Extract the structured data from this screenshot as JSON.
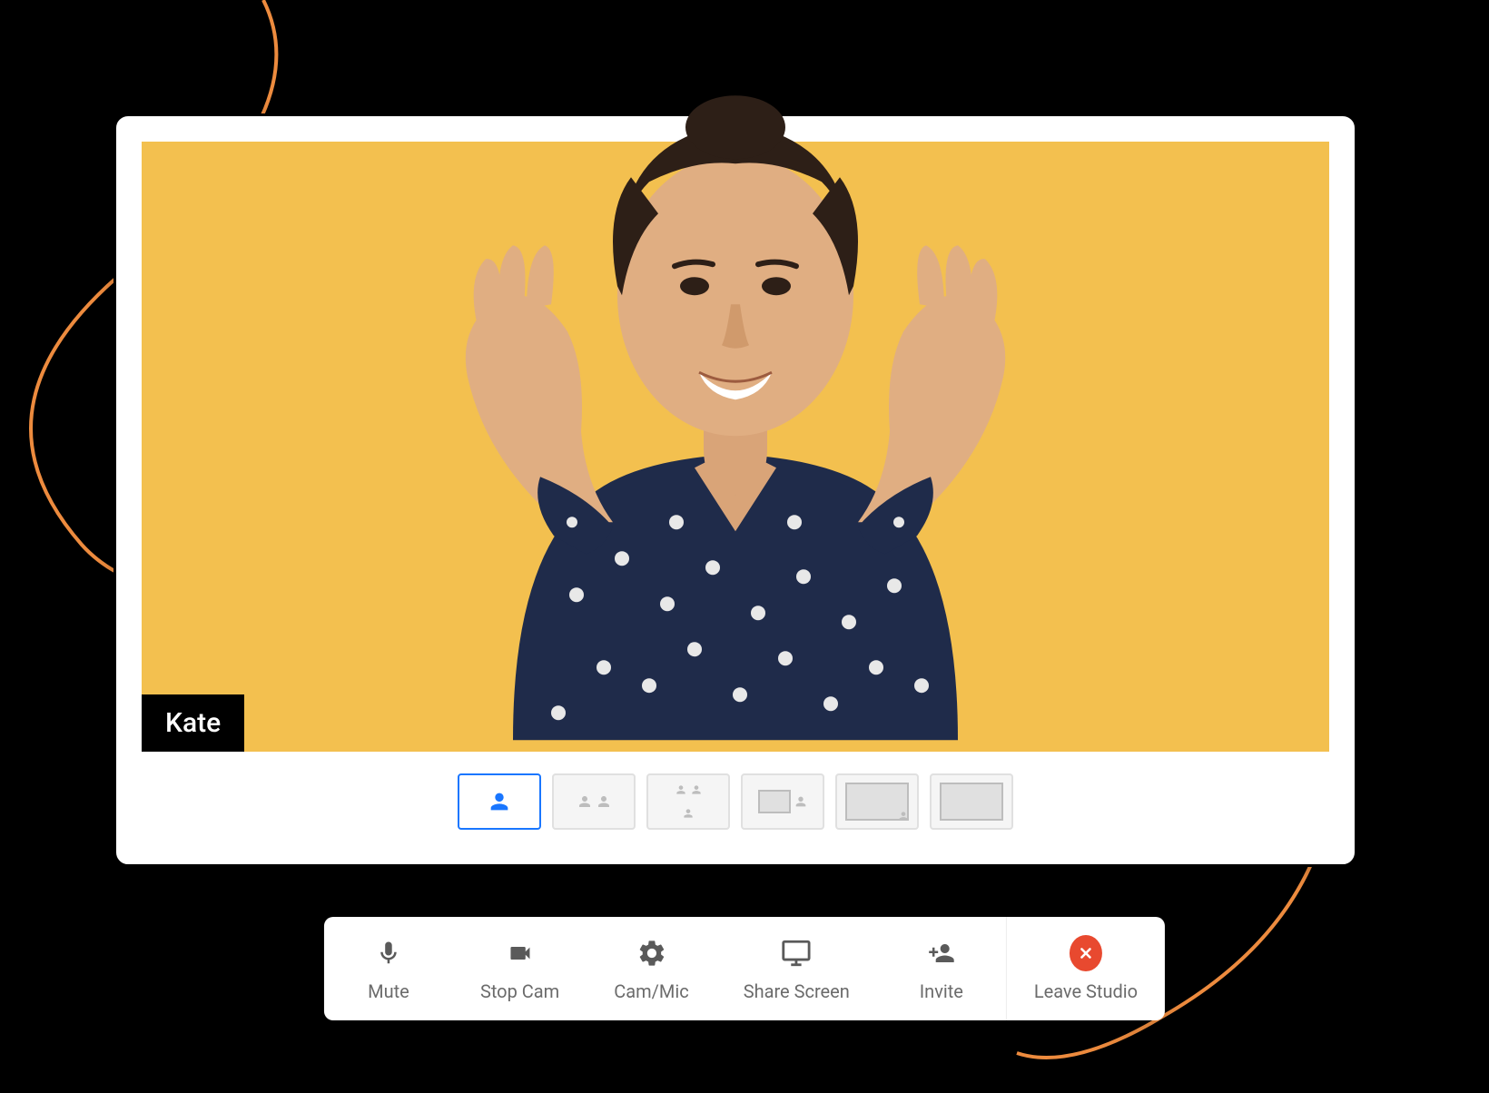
{
  "participant": {
    "name": "Kate"
  },
  "layouts": [
    {
      "id": "single",
      "active": true
    },
    {
      "id": "two-up",
      "active": false
    },
    {
      "id": "three-up",
      "active": false
    },
    {
      "id": "screen-side",
      "active": false
    },
    {
      "id": "screen-pip",
      "active": false
    },
    {
      "id": "screen-only",
      "active": false
    }
  ],
  "toolbar": {
    "mute": {
      "label": "Mute",
      "icon": "microphone-icon"
    },
    "stop_cam": {
      "label": "Stop Cam",
      "icon": "video-camera-icon"
    },
    "cam_mic": {
      "label": "Cam/Mic",
      "icon": "gear-icon"
    },
    "share_screen": {
      "label": "Share Screen",
      "icon": "monitor-icon"
    },
    "invite": {
      "label": "Invite",
      "icon": "add-user-icon"
    },
    "leave": {
      "label": "Leave Studio",
      "icon": "close-icon"
    }
  },
  "colors": {
    "accent": "#1976ff",
    "video_bg": "#f3c04f",
    "leave_button": "#e8492f",
    "swirl": "#ed8b3e"
  }
}
